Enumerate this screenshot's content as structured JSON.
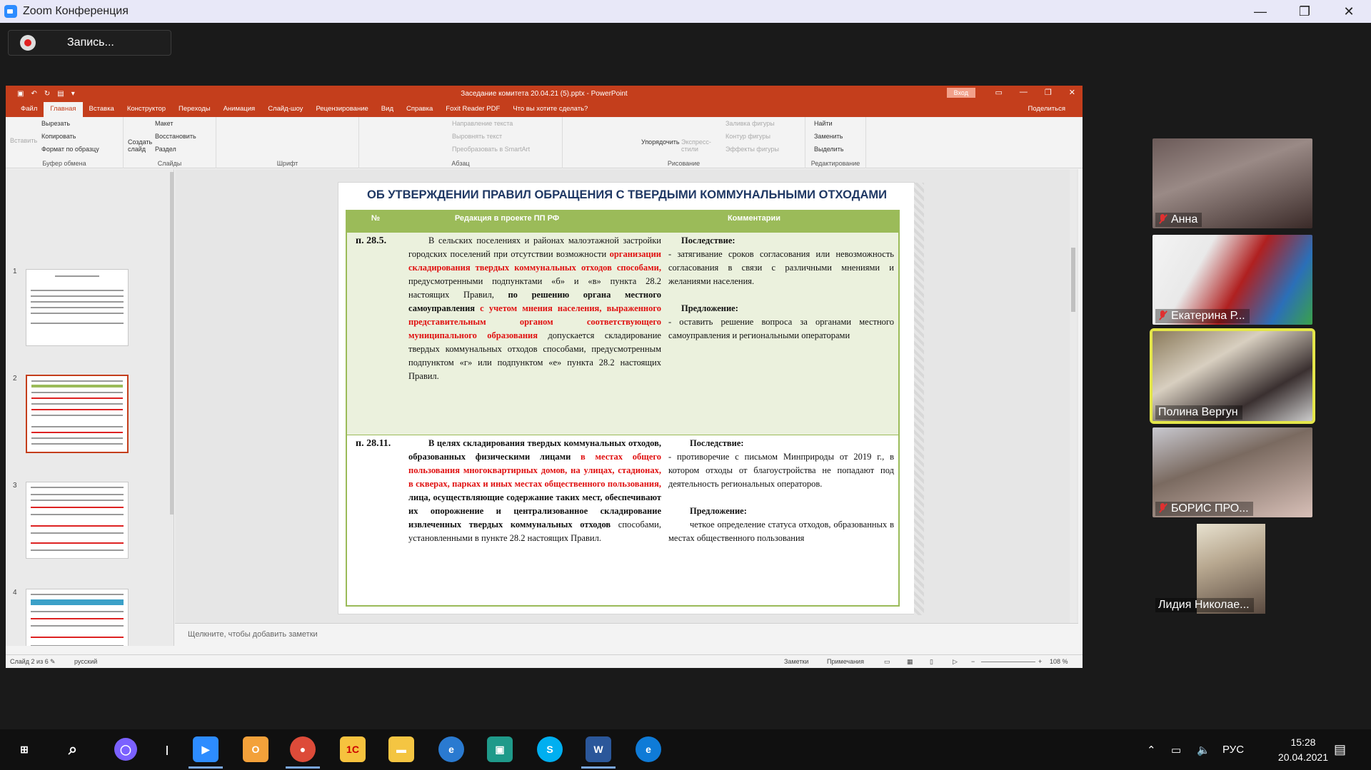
{
  "zoom": {
    "window_title": "Zoom Конференция",
    "recording_label": "Запись...",
    "win_minimize": "—",
    "win_restore": "❐",
    "win_close": "✕"
  },
  "ppt": {
    "doc_title": "Заседание комитета 20.04.21 (5).pptx - PowerPoint",
    "signin": "Вход",
    "share": "Поделиться",
    "tabs": [
      "Файл",
      "Главная",
      "Вставка",
      "Конструктор",
      "Переходы",
      "Анимация",
      "Слайд-шоу",
      "Рецензирование",
      "Вид",
      "Справка",
      "Foxit Reader PDF",
      "Что вы хотите сделать?"
    ],
    "ribbon": {
      "paste": "Вставить",
      "cut": "Вырезать",
      "copy": "Копировать",
      "format_painter": "Формат по образцу",
      "clipboard": "Буфер обмена",
      "new_slide": "Создать слайд",
      "layout": "Макет",
      "reset": "Восстановить",
      "section": "Раздел",
      "slides": "Слайды",
      "font": "Шрифт",
      "text_direction": "Направление текста",
      "align_text": "Выровнять текст",
      "smartart": "Преобразовать в SmartArt",
      "paragraph": "Абзац",
      "arrange": "Упорядочить",
      "quick_styles": "Экспресс-стили",
      "shape_fill": "Заливка фигуры",
      "shape_outline": "Контур фигуры",
      "shape_effects": "Эффекты фигуры",
      "drawing": "Рисование",
      "find": "Найти",
      "replace": "Заменить",
      "select": "Выделить",
      "editing": "Редактирование"
    },
    "thumb_numbers": [
      "1",
      "2",
      "3",
      "4",
      "5"
    ],
    "notes_placeholder": "Щелкните, чтобы добавить заметки",
    "status": {
      "slide_of": "Слайд 2 из 6",
      "language": "русский",
      "notes": "Заметки",
      "comments": "Примечания",
      "zoom": "108 %"
    }
  },
  "slide": {
    "title": "ОБ УТВЕРЖДЕНИИ ПРАВИЛ ОБРАЩЕНИЯ С ТВЕРДЫМИ КОММУНАЛЬНЫМИ ОТХОДАМИ",
    "col_num": "№",
    "col_edition": "Редакция в проекте ПП РФ",
    "col_comments": "Комментарии",
    "row1": {
      "num": "п. 28.5.",
      "t1": "В сельских поселениях и районах малоэтажной застройки городских поселений при отсутствии возможности ",
      "t1_red": "организации складирования твердых коммунальных отходов способами,",
      "t2": " предусмотренными подпунктами «б» и «в» пункта 28.2 настоящих Правил, ",
      "t2_bold": "по решению органа местного самоуправления ",
      "t3_red": "с учетом мнения населения, выраженного представительным органом соответствующего муниципального образования",
      "t4": " допускается складирование твердых коммунальных отходов способами, предусмотренным подпунктом «г» или подпунктом «е» пункта 28.2 настоящих Правил.",
      "consequence_h": "Последствие:",
      "consequence": "- затягивание сроков согласования или невозможность согласования в связи с различными мнениями и желаниями населения.",
      "proposal_h": "Предложение:",
      "proposal": "- оставить решение вопроса за органами местного самоуправления и региональными операторами"
    },
    "row2": {
      "num": "п. 28.11.",
      "t1_bold": "В целях складирования твердых коммунальных отходов, образованных физическими лицами ",
      "t2_red": "в местах общего пользования многоквартирных домов, на улицах, стадионах, в скверах, парках и иных местах общественного пользования,",
      "t3_bold": " лица, осуществляющие содержание таких мест, обеспечивают их опорожнение и централизованное складирование извлеченных твердых коммунальных отходов",
      "t4": " способами, установленными в пункте 28.2 настоящих Правил.",
      "consequence_h": "Последствие:",
      "consequence": "- противоречие с письмом Минприроды от 2019 г., в котором отходы от благоустройства не попадают под деятельность региональных операторов.",
      "proposal_h": "Предложение:",
      "proposal": "четкое определение статуса отходов, образованных в местах общественного пользования"
    }
  },
  "participants": [
    {
      "name": "Анна",
      "muted": true
    },
    {
      "name": "Екатерина Р...",
      "muted": true
    },
    {
      "name": "Полина Вергун",
      "muted": false,
      "active": true
    },
    {
      "name": "БОРИС ПРО...",
      "muted": true
    },
    {
      "name": "Лидия Николае...",
      "muted": false
    }
  ],
  "taskbar": {
    "lang": "РУС",
    "time": "15:28",
    "date": "20.04.2021",
    "apps": [
      "start",
      "search",
      "cortana",
      "task-view",
      "zoom",
      "outlook",
      "chrome",
      "1c",
      "explorer",
      "ie",
      "photos",
      "skype",
      "word",
      "edge"
    ]
  },
  "colors": {
    "zoom_bg": "#1a1a1a",
    "ppt_accent": "#c43e1c",
    "table_green": "#9bbb59",
    "red_text": "#e01010",
    "active_speaker": "#e4e64a"
  }
}
